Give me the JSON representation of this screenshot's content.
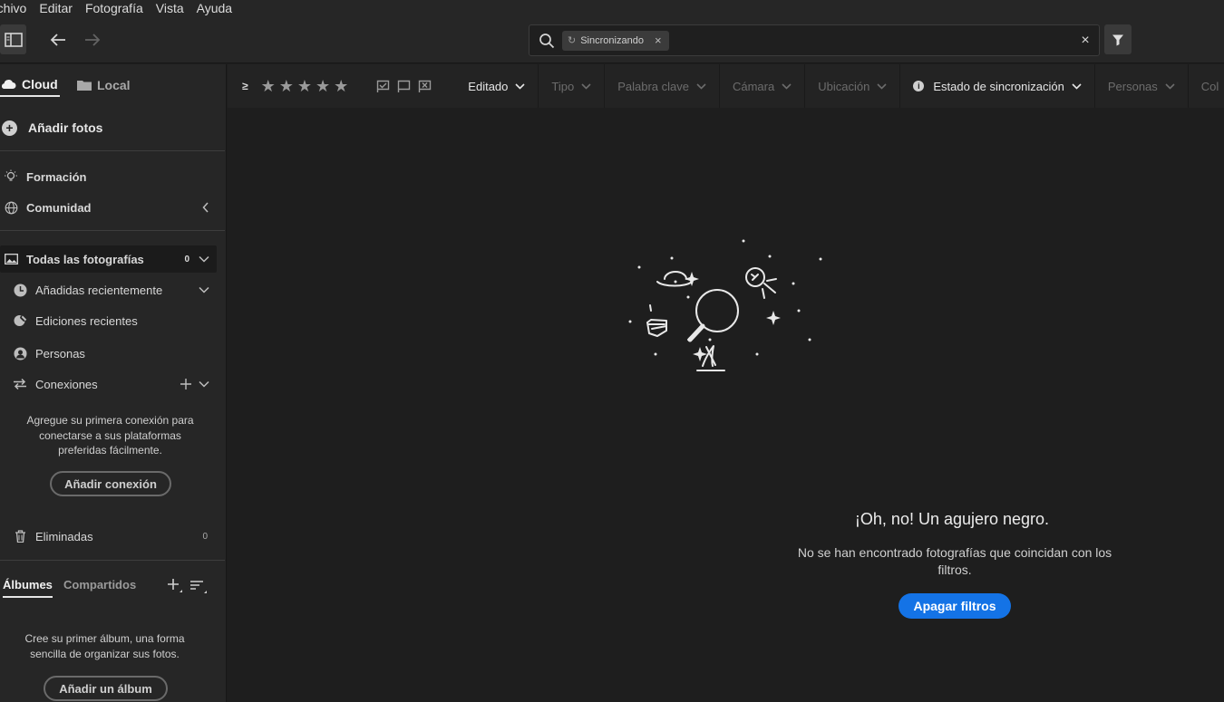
{
  "menu": [
    "rchivo",
    "Editar",
    "Fotografía",
    "Vista",
    "Ayuda"
  ],
  "search": {
    "chip": "Sincronizando",
    "chip_close": "×",
    "clear": "×",
    "placeholder": ""
  },
  "sidebar": {
    "tabs": {
      "cloud": "Cloud",
      "local": "Local"
    },
    "add_photos": "Añadir fotos",
    "learn": "Formación",
    "community": "Comunidad",
    "all_photos": "Todas las fotografías",
    "all_photos_count": "0",
    "recently_added": "Añadidas recientemente",
    "recent_edits": "Ediciones recientes",
    "people": "Personas",
    "connections": "Conexiones",
    "connections_hint": "Agregue su primera conexión para conectarse a sus plataformas preferidas fácilmente.",
    "add_connection": "Añadir conexión",
    "deleted": "Eliminadas",
    "deleted_count": "0",
    "albums_tab": "Álbumes",
    "shared_tab": "Compartidos",
    "albums_hint": "Cree su primer álbum, una forma sencilla de organizar sus fotos.",
    "add_album": "Añadir un álbum"
  },
  "filterbar": {
    "ge": "≥",
    "stars": [
      "★",
      "★",
      "★",
      "★",
      "★"
    ],
    "dropdowns": [
      {
        "label": "Editado",
        "active": true
      },
      {
        "label": "Tipo",
        "active": false
      },
      {
        "label": "Palabra clave",
        "active": false
      },
      {
        "label": "Cámara",
        "active": false
      },
      {
        "label": "Ubicación",
        "active": false
      },
      {
        "label": "Estado de sincronización",
        "active": true
      },
      {
        "label": "Personas",
        "active": false
      },
      {
        "label": "Col",
        "active": false
      }
    ]
  },
  "empty": {
    "title": "¡Oh, no! Un agujero negro.",
    "message": "No se han encontrado fotografías que coincidan con los filtros.",
    "button": "Apagar filtros"
  },
  "colors": {
    "accent": "#1473e6",
    "background": "#1e1e1e",
    "panel": "#262626"
  }
}
